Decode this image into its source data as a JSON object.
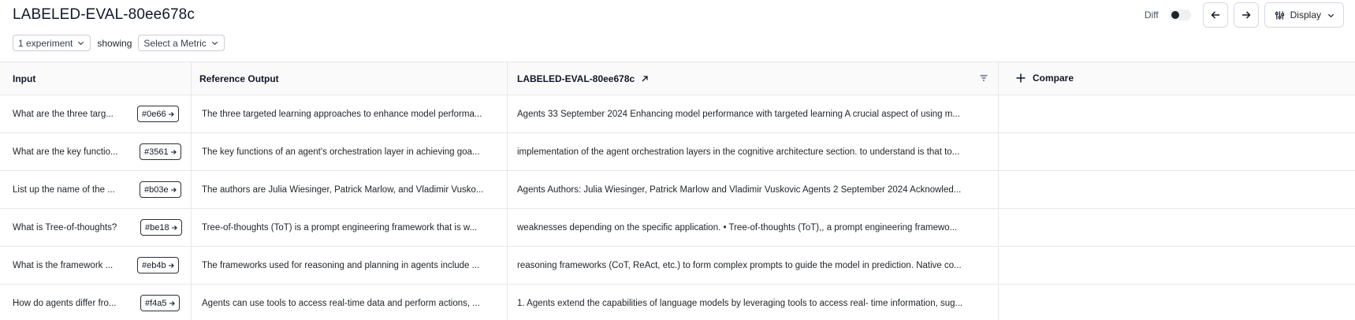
{
  "header": {
    "title": "LABELED-EVAL-80ee678c",
    "experiment_dropdown": "1 experiment",
    "showing_label": "showing",
    "metric_dropdown": "Select a Metric",
    "diff_label": "Diff",
    "display_label": "Display"
  },
  "table": {
    "columns": {
      "input": "Input",
      "reference": "Reference Output",
      "experiment": "LABELED-EVAL-80ee678c",
      "compare": "Compare"
    },
    "rows": [
      {
        "input": "What are the three targ...",
        "id": "#0e66",
        "reference": "The three targeted learning approaches to enhance model performa...",
        "output": "Agents 33 September 2024 Enhancing model performance with targeted learning A crucial aspect of using m..."
      },
      {
        "input": "What are the key functio...",
        "id": "#3561",
        "reference": "The key functions of an agent's orchestration layer in achieving goa...",
        "output": "implementation of the agent orchestration layers in the cognitive architecture section. to understand is that to..."
      },
      {
        "input": "List up the name of the ...",
        "id": "#b03e",
        "reference": "The authors are Julia Wiesinger, Patrick Marlow, and Vladimir Vusko...",
        "output": "Agents Authors: Julia Wiesinger, Patrick Marlow and Vladimir Vuskovic Agents 2 September 2024 Acknowled..."
      },
      {
        "input": "What is Tree-of-thoughts?",
        "id": "#be18",
        "reference": "Tree-of-thoughts (ToT) is a prompt engineering framework that is w...",
        "output": "weaknesses depending on the specific application. • Tree-of-thoughts (ToT),, a prompt engineering framewo..."
      },
      {
        "input": "What is the framework ...",
        "id": "#eb4b",
        "reference": "The frameworks used for reasoning and planning in agents include ...",
        "output": "reasoning frameworks (CoT, ReAct, etc.) to form complex prompts to guide the model in prediction. Native co..."
      },
      {
        "input": "How do agents differ fro...",
        "id": "#f4a5",
        "reference": "Agents can use tools to access real-time data and perform actions, ...",
        "output": "1. Agents extend the capabilities of language models by leveraging tools to access real- time information, sug..."
      }
    ]
  }
}
